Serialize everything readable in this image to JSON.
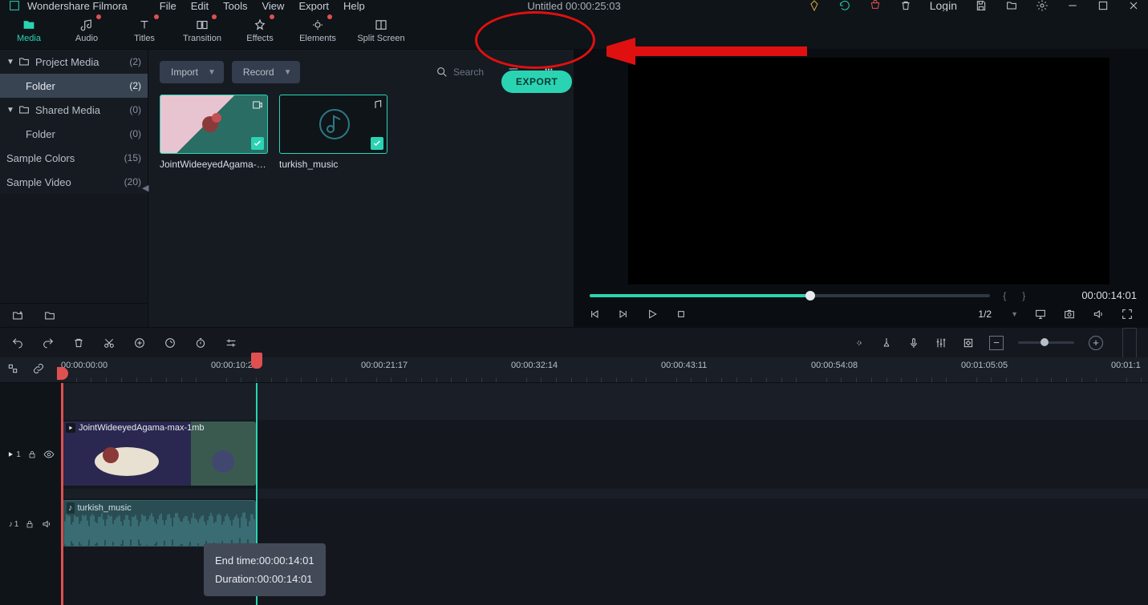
{
  "app_title": "Wondershare Filmora",
  "menus": [
    "File",
    "Edit",
    "Tools",
    "View",
    "Export",
    "Help"
  ],
  "title_center": "Untitled   00:00:25:03",
  "login_label": "Login",
  "main_tabs": [
    {
      "label": "Media",
      "active": true
    },
    {
      "label": "Audio",
      "dot": true
    },
    {
      "label": "Titles",
      "dot": true
    },
    {
      "label": "Transition",
      "dot": true
    },
    {
      "label": "Effects",
      "dot": true
    },
    {
      "label": "Elements",
      "dot": true
    },
    {
      "label": "Split Screen"
    }
  ],
  "sidebar": [
    {
      "label": "Project Media",
      "count": "(2)",
      "chev": true,
      "folder": true
    },
    {
      "label": "Folder",
      "count": "(2)",
      "indent": true,
      "sel": true
    },
    {
      "label": "Shared Media",
      "count": "(0)",
      "chev": true,
      "folder": true
    },
    {
      "label": "Folder",
      "count": "(0)",
      "indent": true
    },
    {
      "label": "Sample Colors",
      "count": "(15)"
    },
    {
      "label": "Sample Video",
      "count": "(20)"
    }
  ],
  "import_label": "Import",
  "record_label": "Record",
  "search_placeholder": "Search",
  "export_label": "EXPORT",
  "thumbs": [
    {
      "name": "JointWideeyedAgama-ma..."
    },
    {
      "name": "turkish_music"
    }
  ],
  "preview": {
    "timecode": "00:00:14:01",
    "ratio": "1/2"
  },
  "ruler_ticks": [
    "00:00:00:00",
    "00:00:10:20",
    "00:00:21:17",
    "00:00:32:14",
    "00:00:43:11",
    "00:00:54:08",
    "00:01:05:05",
    "00:01:1"
  ],
  "clips": {
    "video_label": "JointWideeyedAgama-max-1mb",
    "audio_label": "turkish_music"
  },
  "tooltip": {
    "end": "End time:00:00:14:01",
    "dur": "Duration:00:00:14:01"
  },
  "tracks": {
    "video_head": "1",
    "audio_head": "1"
  }
}
